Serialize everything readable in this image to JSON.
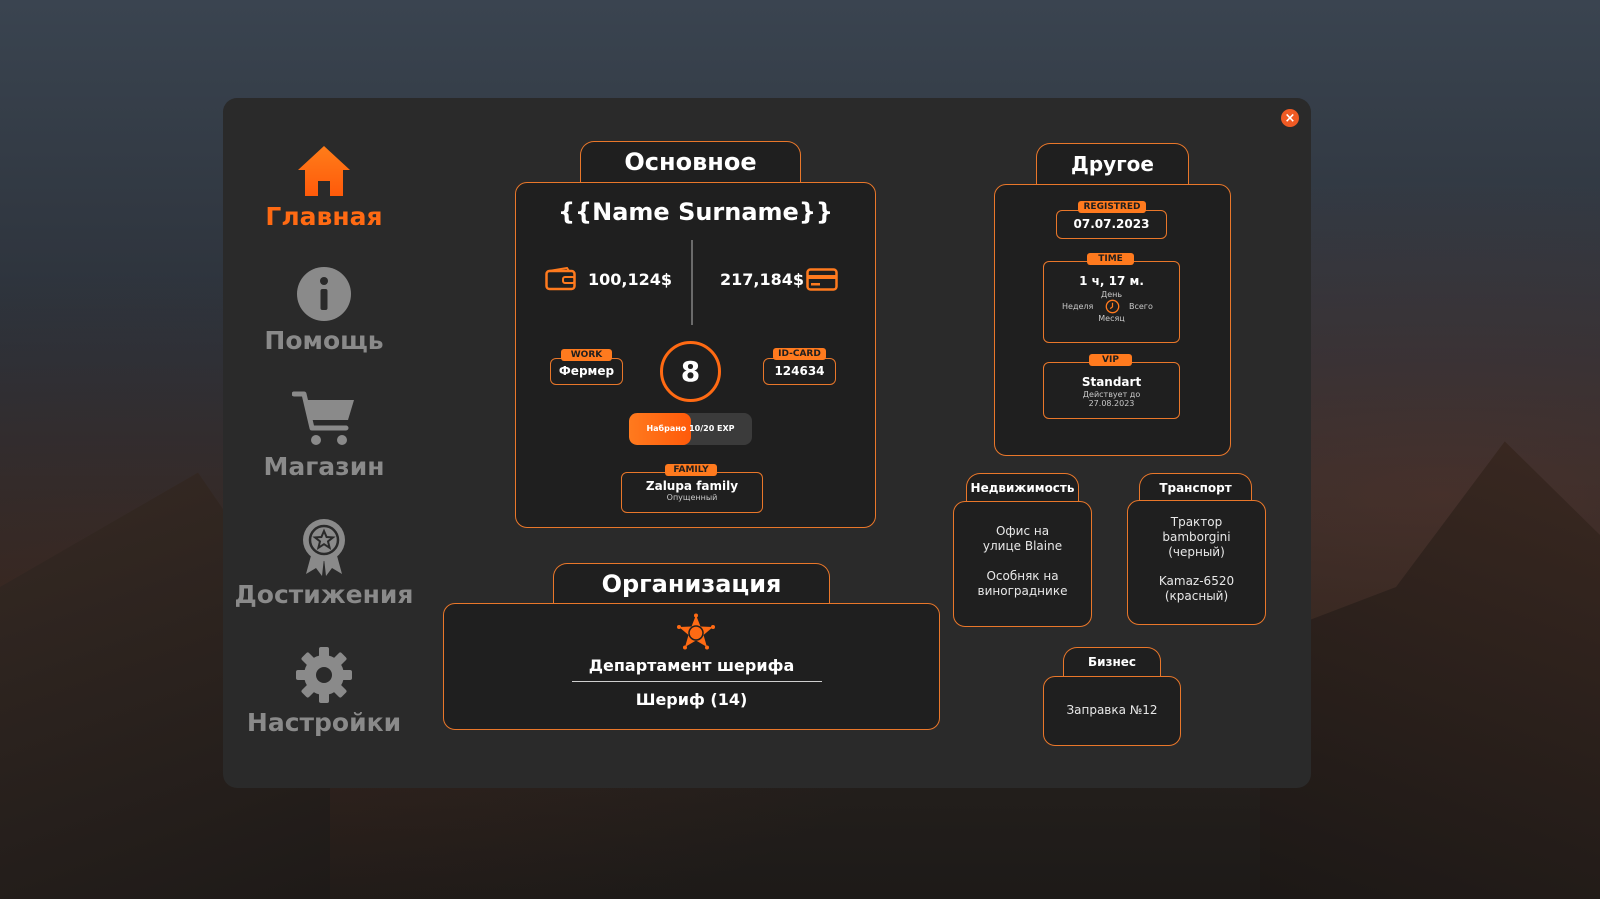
{
  "nav": {
    "items": [
      {
        "label": "Главная",
        "active": true
      },
      {
        "label": "Помощь",
        "active": false
      },
      {
        "label": "Магазин",
        "active": false
      },
      {
        "label": "Достижения",
        "active": false
      },
      {
        "label": "Настройки",
        "active": false
      }
    ]
  },
  "main": {
    "title": "Основное",
    "name": "{{Name Surname}}",
    "cash": "100,124$",
    "bank": "217,184$",
    "work": {
      "tag": "WORK",
      "value": "Фермер"
    },
    "level": "8",
    "idcard": {
      "tag": "ID-CARD",
      "value": "124634"
    },
    "exp": {
      "label": "Набрано 10/20 EXP",
      "progress": 0.5
    },
    "family": {
      "tag": "FAMILY",
      "name": "Zalupa family",
      "rank": "Опущенный"
    }
  },
  "org": {
    "title": "Организация",
    "name": "Департамент шерифа",
    "rank": "Шериф (14)"
  },
  "other": {
    "title": "Другое",
    "registered": {
      "tag": "REGISTRED",
      "value": "07.07.2023"
    },
    "time": {
      "tag": "TIME",
      "value": "1 ч, 17 м.",
      "day": "День",
      "week": "Неделя",
      "total": "Всего",
      "month": "Месяц"
    },
    "vip": {
      "tag": "VIP",
      "level": "Standart",
      "until_label": "Действует до",
      "until_date": "27.08.2023"
    }
  },
  "realty": {
    "title": "Недвижимость",
    "items": [
      "Офис на улице Blaine",
      "Особняк на винограднике"
    ]
  },
  "transport": {
    "title": "Транспорт",
    "items": [
      "Трактор bamborgini (черный)",
      "Kamaz-6520 (красный)"
    ]
  },
  "business": {
    "title": "Бизнес",
    "items": [
      "Заправка №12"
    ]
  },
  "colors": {
    "accent": "#ff6a13",
    "panel": "#2a2a2a",
    "card": "#1f1f1f",
    "muted": "#8a8a8a"
  }
}
